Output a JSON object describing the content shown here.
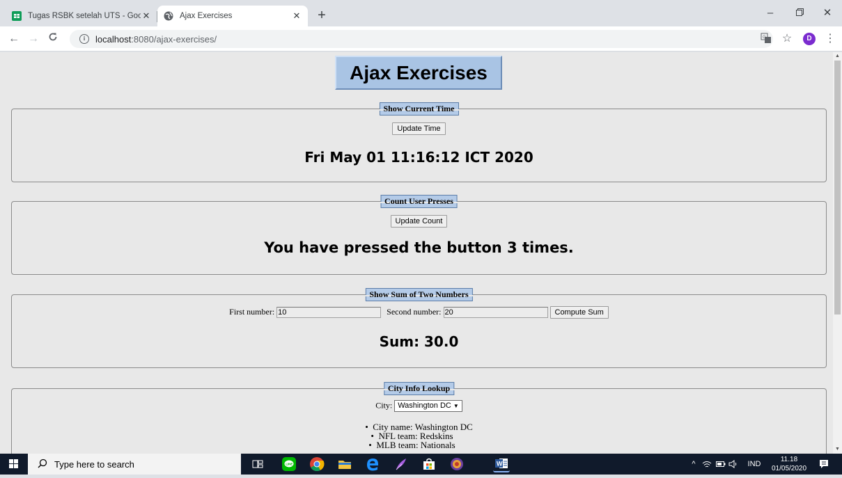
{
  "browser": {
    "tabs": [
      {
        "title": "Tugas RSBK setelah UTS - Google",
        "active": false
      },
      {
        "title": "Ajax Exercises",
        "active": true
      }
    ],
    "url_host": "localhost",
    "url_rest": ":8080/ajax-exercises/",
    "avatar_letter": "D"
  },
  "page": {
    "heading": "Ajax Exercises",
    "sections": {
      "time": {
        "legend": "Show Current Time",
        "button": "Update Time",
        "result": "Fri May 01 11:16:12 ICT 2020"
      },
      "count": {
        "legend": "Count User Presses",
        "button": "Update Count",
        "result": "You have pressed the button 3 times."
      },
      "sum": {
        "legend": "Show Sum of Two Numbers",
        "first_label": "First number:",
        "first_value": "10",
        "second_label": "Second number:",
        "second_value": "20",
        "button": "Compute Sum",
        "result": "Sum: 30.0"
      },
      "city": {
        "legend": "City Info Lookup",
        "label": "City:",
        "selected": "Washington DC",
        "info": [
          "City name: Washington DC",
          "NFL team: Redskins",
          "MLB team: Nationals"
        ]
      }
    }
  },
  "taskbar": {
    "search_placeholder": "Type here to search",
    "language": "IND",
    "time": "11.18",
    "date": "01/05/2020"
  },
  "colors": {
    "page_bg": "#e8e8e8",
    "legend_bg": "#b4cbe8",
    "heading_bg": "#a9c4e4",
    "taskbar_bg": "#101a2b"
  }
}
